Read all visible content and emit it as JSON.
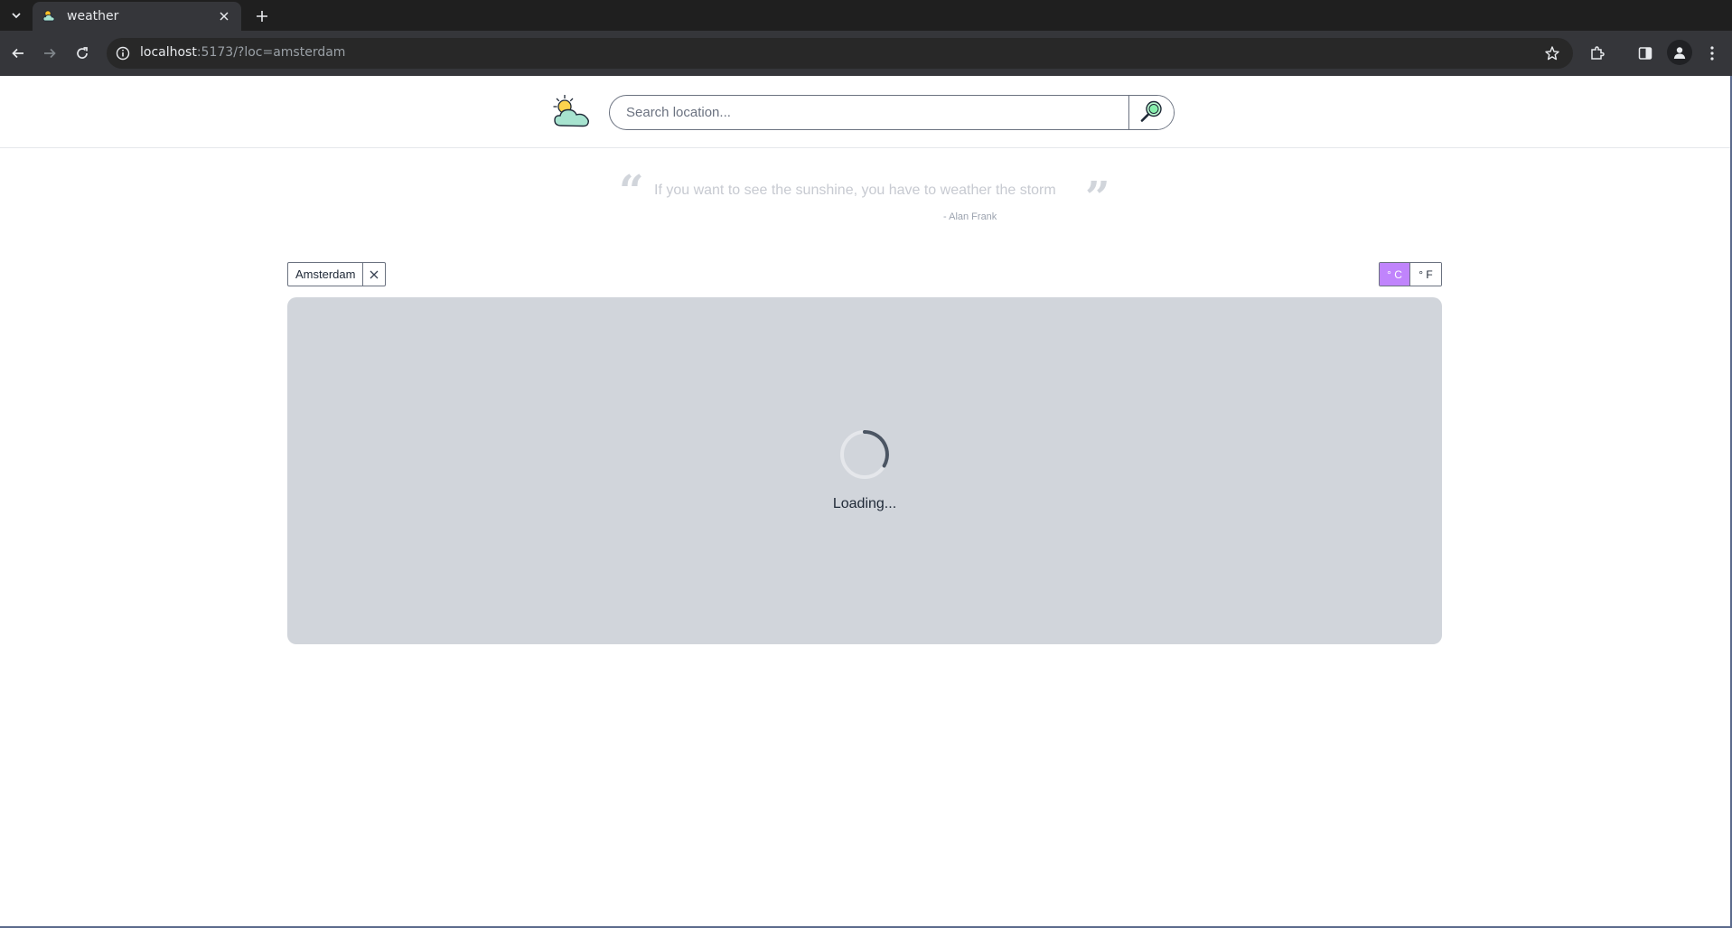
{
  "browser": {
    "tab": {
      "title": "weather"
    },
    "address": {
      "host": "localhost",
      "path": ":5173/?loc=amsterdam"
    }
  },
  "app": {
    "search": {
      "placeholder": "Search location..."
    },
    "quote": {
      "text": "If you want to see the sunshine, you have to weather the storm",
      "author": "- Alan Frank"
    },
    "location_chip": {
      "label": "Amsterdam"
    },
    "units": {
      "celsius": "° C",
      "fahrenheit": "° F",
      "selected": "celsius"
    },
    "panel": {
      "status": "Loading..."
    }
  },
  "colors": {
    "accent": "#c084fc",
    "panel_bg": "#d1d5db",
    "chrome_dark": "#1f1f1f",
    "chrome_toolbar": "#35363a"
  },
  "icons": {
    "tab_list": "chevron-down-icon",
    "tab_favicon": "sun-cloud-icon",
    "tab_close": "close-icon",
    "new_tab": "plus-icon",
    "back": "arrow-left-icon",
    "forward": "arrow-right-icon",
    "reload": "reload-icon",
    "site_info": "info-icon",
    "bookmark": "star-icon",
    "extensions": "puzzle-icon",
    "side_panel": "side-panel-icon",
    "profile": "person-icon",
    "menu": "kebab-menu-icon",
    "logo": "sun-cloud-icon",
    "search": "magnifier-icon",
    "remove": "close-icon"
  }
}
